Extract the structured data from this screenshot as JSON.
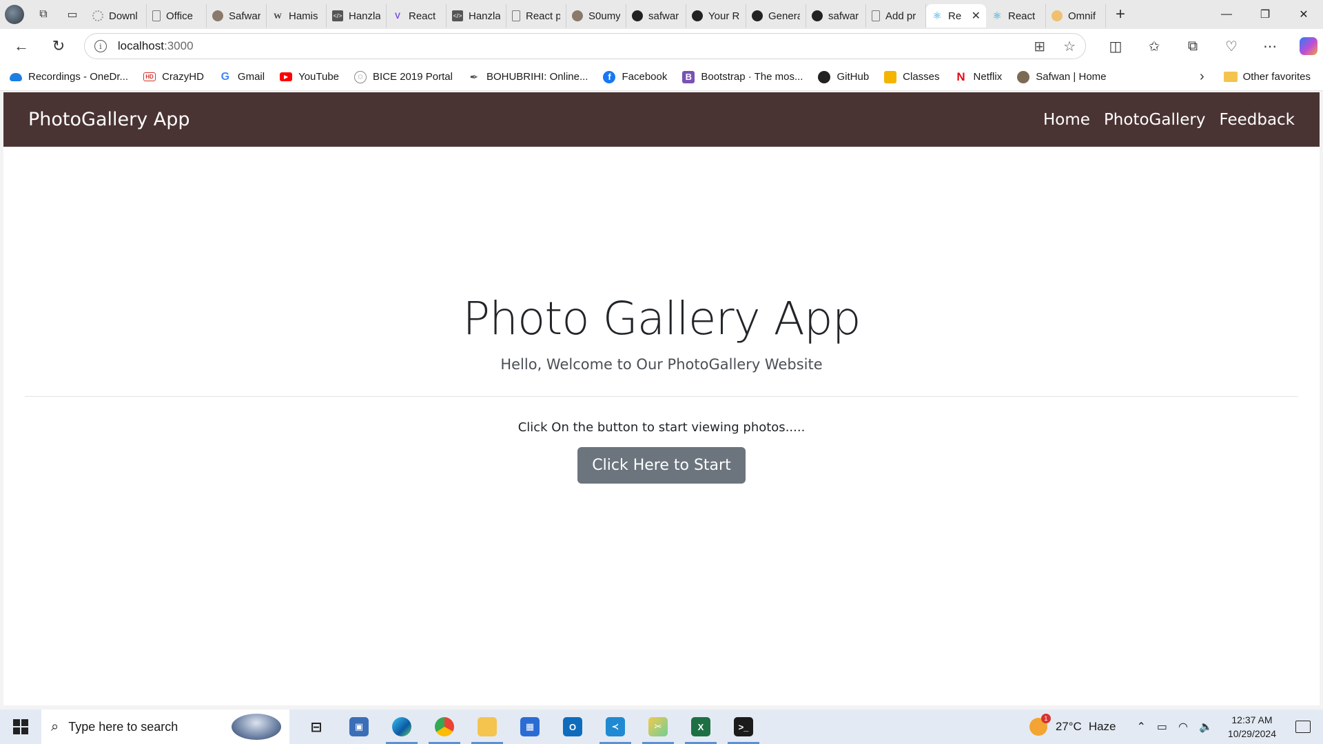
{
  "browser": {
    "tabs": [
      {
        "title": "Downl",
        "icon": "gear-icon"
      },
      {
        "title": "Office",
        "icon": "document-icon"
      },
      {
        "title": "Safwar",
        "icon": "avatar-icon"
      },
      {
        "title": "Hamis",
        "icon": "wikipedia-icon"
      },
      {
        "title": "Hanzla",
        "icon": "code-icon"
      },
      {
        "title": "React",
        "icon": "vite-icon"
      },
      {
        "title": "Hanzla",
        "icon": "code-icon"
      },
      {
        "title": "React p",
        "icon": "document-icon"
      },
      {
        "title": "S0umy",
        "icon": "avatar-icon"
      },
      {
        "title": "safwar",
        "icon": "github-icon"
      },
      {
        "title": "Your R",
        "icon": "github-icon"
      },
      {
        "title": "Genera",
        "icon": "github-icon"
      },
      {
        "title": "safwar",
        "icon": "github-icon"
      },
      {
        "title": "Add pr",
        "icon": "document-icon"
      },
      {
        "title": "Re",
        "icon": "react-icon",
        "active": true
      },
      {
        "title": "React",
        "icon": "react-icon"
      },
      {
        "title": "Omnif",
        "icon": "omnifood-icon"
      }
    ],
    "url_host": "localhost",
    "url_port": ":3000",
    "bookmarks": [
      {
        "label": "Recordings - OneDr...",
        "icon": "onedrive-icon"
      },
      {
        "label": "CrazyHD",
        "icon": "hd-icon"
      },
      {
        "label": "Gmail",
        "icon": "google-icon"
      },
      {
        "label": "YouTube",
        "icon": "youtube-icon"
      },
      {
        "label": "BICE 2019 Portal",
        "icon": "hexagon-icon"
      },
      {
        "label": "BOHUBRIHI: Online...",
        "icon": "quill-icon"
      },
      {
        "label": "Facebook",
        "icon": "facebook-icon"
      },
      {
        "label": "Bootstrap · The mos...",
        "icon": "bootstrap-icon"
      },
      {
        "label": "GitHub",
        "icon": "github-icon"
      },
      {
        "label": "Classes",
        "icon": "classroom-icon"
      },
      {
        "label": "Netflix",
        "icon": "netflix-icon"
      },
      {
        "label": "Safwan | Home",
        "icon": "avatar-icon"
      }
    ],
    "other_favorites": "Other favorites"
  },
  "site": {
    "brand": "PhotoGallery App",
    "nav": [
      "Home",
      "PhotoGallery",
      "Feedback"
    ],
    "hero_title": "Photo Gallery App",
    "hero_subtitle": "Hello, Welcome to Our PhotoGallery Website",
    "prompt": "Click On the button to start viewing photos.....",
    "start_button": "Click Here to Start",
    "nav_color": "#4a3433",
    "button_color": "#6c757d"
  },
  "taskbar": {
    "search_placeholder": "Type here to search",
    "weather_temp": "27°C",
    "weather_cond": "Haze",
    "weather_badge": "1",
    "time": "12:37 AM",
    "date": "10/29/2024"
  }
}
